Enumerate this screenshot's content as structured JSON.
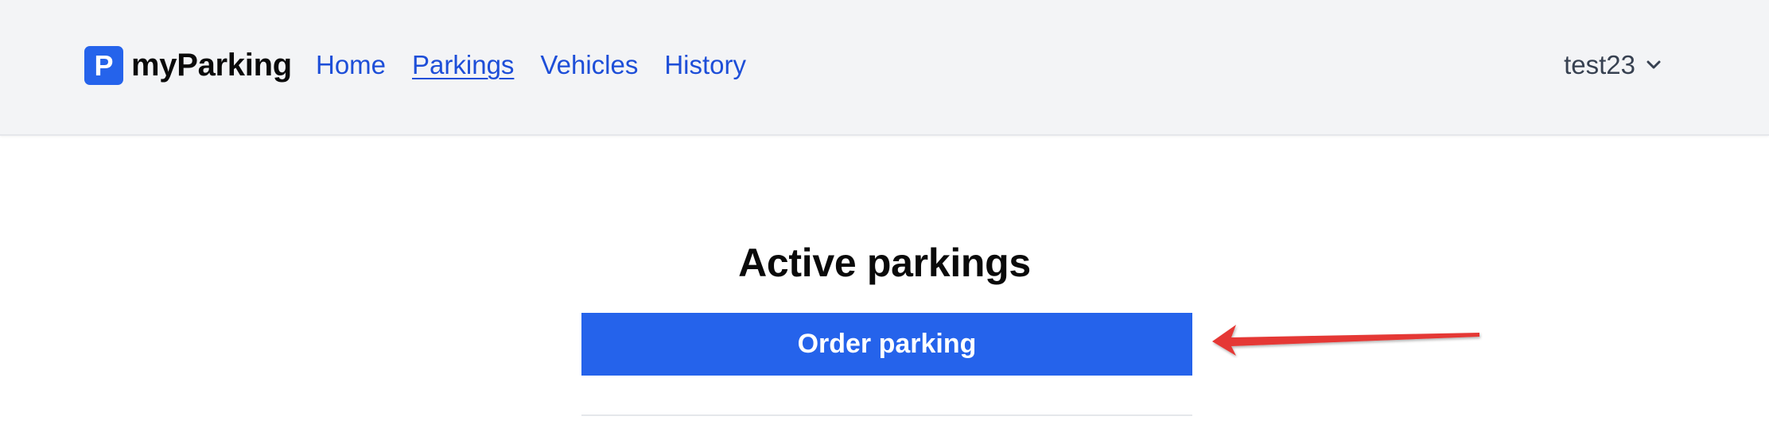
{
  "header": {
    "brand": {
      "icon_letter": "P",
      "name": "myParking"
    },
    "nav": [
      {
        "label": "Home",
        "active": false
      },
      {
        "label": "Parkings",
        "active": true
      },
      {
        "label": "Vehicles",
        "active": false
      },
      {
        "label": "History",
        "active": false
      }
    ],
    "user": {
      "name": "test23",
      "menu_icon": "chevron-down-icon"
    }
  },
  "main": {
    "title": "Active parkings",
    "order_button_label": "Order parking"
  },
  "annotation": {
    "icon": "red-arrow-annotation",
    "color": "#e53935"
  },
  "colors": {
    "accent": "#2563eb",
    "nav_link": "#1d4ed8",
    "header_bg": "#f3f4f6"
  }
}
